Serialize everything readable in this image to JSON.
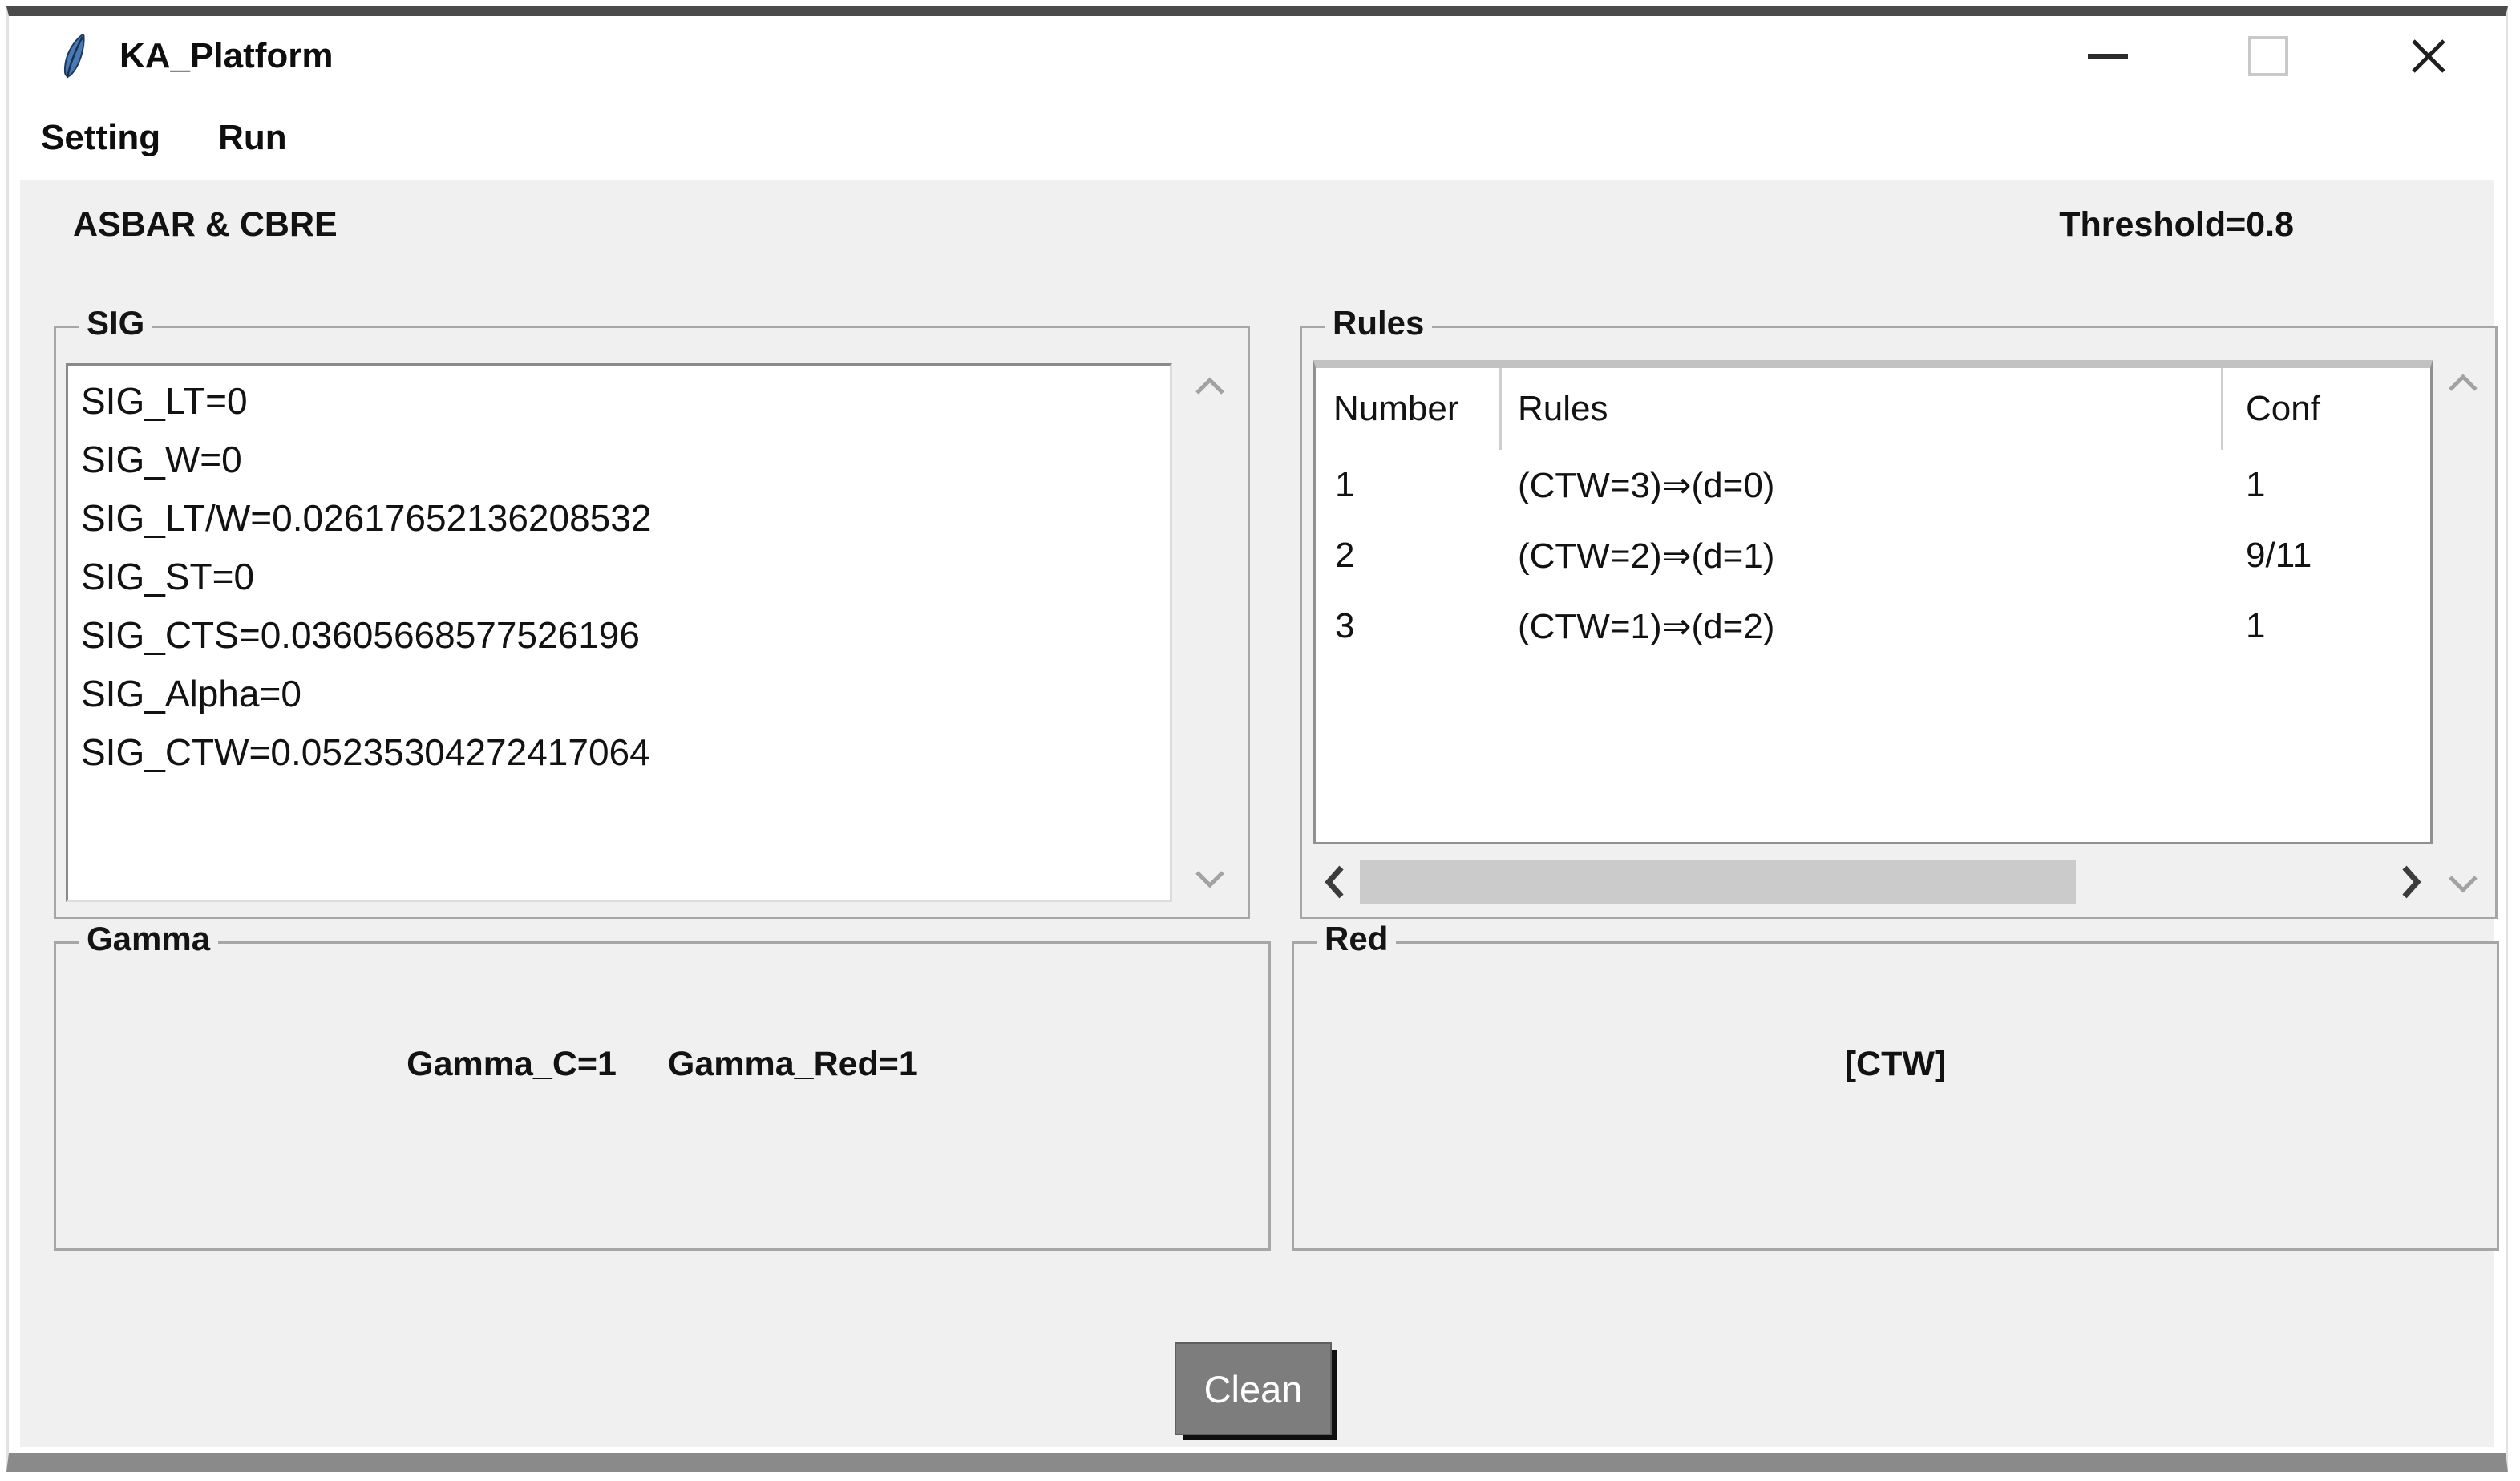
{
  "window": {
    "title": "KA_Platform",
    "icon": "tk-feather-icon"
  },
  "menubar": {
    "items": [
      {
        "label": "Setting"
      },
      {
        "label": "Run"
      }
    ]
  },
  "header": {
    "left": "ASBAR & CBRE",
    "right": "Threshold=0.8"
  },
  "sig": {
    "label": "SIG",
    "lines": [
      "SIG_LT=0",
      "SIG_W=0",
      "SIG_LT/W=0.02617652136208532",
      "SIG_ST=0",
      "SIG_CTS=0.03605668577526196",
      "SIG_Alpha=0",
      "SIG_CTW=0.05235304272417064"
    ]
  },
  "rules": {
    "label": "Rules",
    "columns": [
      "Number",
      "Rules",
      "Conf"
    ],
    "rows": [
      {
        "number": "1",
        "rule": "(CTW=3)⇒(d=0)",
        "conf": "1"
      },
      {
        "number": "2",
        "rule": "(CTW=2)⇒(d=1)",
        "conf": "9/11"
      },
      {
        "number": "3",
        "rule": "(CTW=1)⇒(d=2)",
        "conf": "1"
      }
    ]
  },
  "gamma": {
    "label": "Gamma",
    "gamma_c": "Gamma_C=1",
    "gamma_red": "Gamma_Red=1"
  },
  "red": {
    "label": "Red",
    "value": "[CTW]"
  },
  "actions": {
    "clean": "Clean"
  },
  "colors": {
    "content_bg": "#f0f0f0",
    "titlebar_bg": "#ffffff",
    "clean_button_bg": "#7d7d7d",
    "scroll_thumb": "#cbcbcb",
    "groupbox_border": "#a6a6a6",
    "window_top_border": "#4b4b4b"
  }
}
